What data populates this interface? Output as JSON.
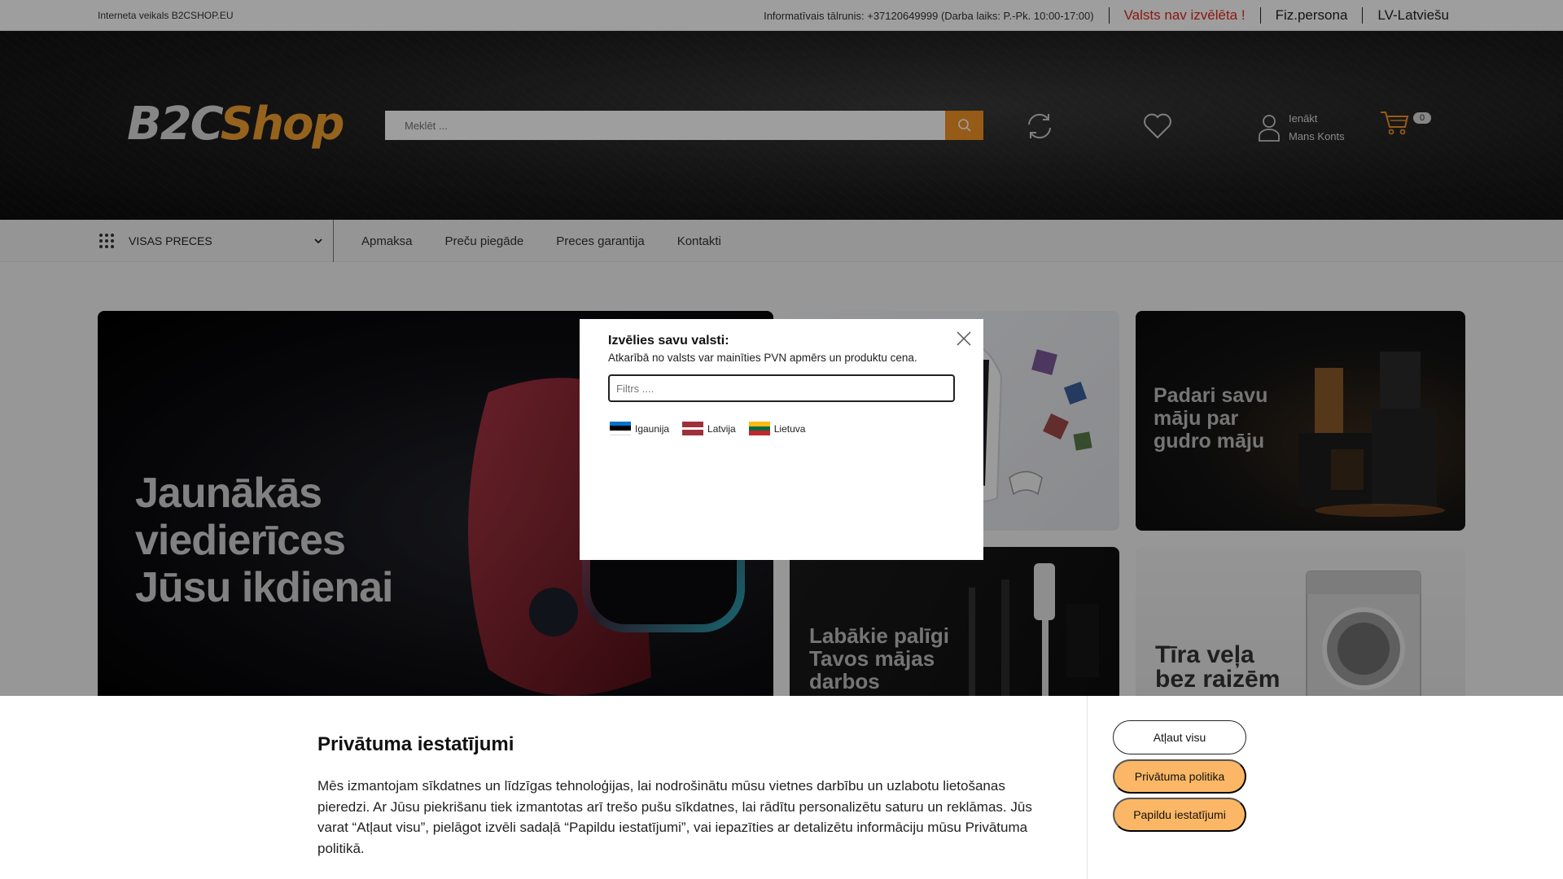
{
  "topbar": {
    "brand": "Interneta veikals B2CSHOP.EU",
    "phone": "Informatīvais tālrunis: +37120649999 (Darba laiks: P.-Pk. 10:00-17:00)",
    "country_status": "Valsts nav izvēlēta !",
    "persona": "Fiz.persona",
    "language": "LV-Latviešu"
  },
  "header": {
    "logo_b2c": "B2C",
    "logo_shop": "Shop",
    "search_placeholder": "Meklēt ...",
    "account_line1": "Ienākt",
    "account_line2": "Mans Konts",
    "cart_count": "0"
  },
  "nav": {
    "all_products": "VISAS PRECES",
    "links": [
      "Apmaksa",
      "Preču piegāde",
      "Preces garantija",
      "Kontakti"
    ]
  },
  "banners": {
    "main": [
      "Jaunākās",
      "viedierīces",
      "Jūsu ikdienai"
    ],
    "smart_home": [
      "Padari savu",
      "māju par",
      "gudro māju"
    ],
    "tools": [
      "Labākie palīgi",
      "Tavos mājas",
      "darbos"
    ],
    "washing": [
      "Tīra veļa",
      "bez raizēm"
    ]
  },
  "modal": {
    "title": "Izvēlies savu valsti:",
    "subtitle": "Atkarībā no valsts var mainīties PVN apmērs un produktu cena.",
    "filter_placeholder": "Filtrs ....",
    "countries": [
      {
        "name": "Igaunija",
        "flag": [
          "#0072ce",
          "#000000",
          "#ffffff"
        ]
      },
      {
        "name": "Latvija",
        "flag": [
          "#9e3039",
          "#ffffff",
          "#9e3039"
        ]
      },
      {
        "name": "Lietuva",
        "flag": [
          "#fdb913",
          "#006a44",
          "#c1272d"
        ]
      }
    ]
  },
  "cookie": {
    "title": "Privātuma iestatījumi",
    "body": "Mēs izmantojam sīkdatnes un līdzīgas tehnoloģijas, lai nodrošinātu mūsu vietnes darbību un uzlabotu lietošanas pieredzi. Ar Jūsu piekrišanu tiek izmantotas arī trešo pušu sīkdatnes, lai rādītu personalizētu saturu un reklāmas. Jūs varat “Atļaut visu”, pielāgot izvēli sadaļā “Papildu iestatījumi”, vai iepazīties ar detalizētu informāciju mūsu Privātuma politikā.",
    "allow_all": "Atļaut visu",
    "privacy_policy": "Privātuma politika",
    "more_settings": "Papildu iestatījumi"
  },
  "colors": {
    "accent": "#f39324",
    "warning": "#e0281c",
    "cookie_button": "#fbb765"
  }
}
